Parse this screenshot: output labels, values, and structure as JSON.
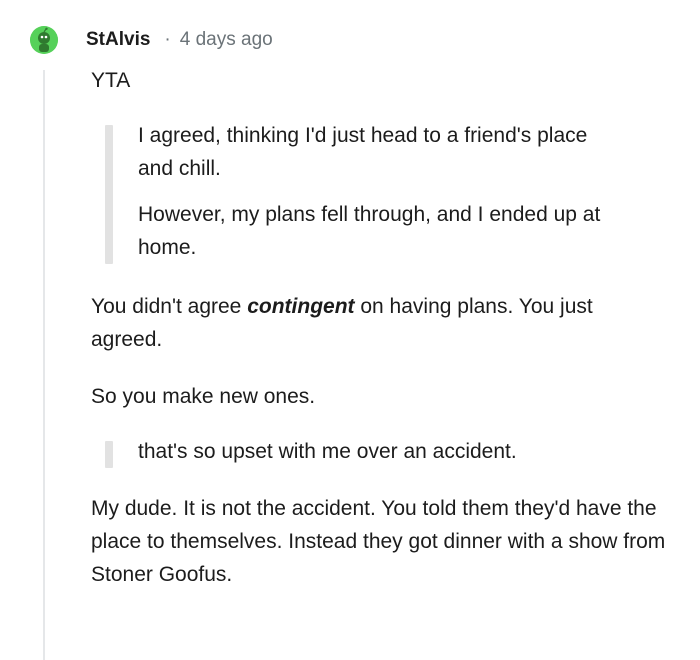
{
  "comment": {
    "username": "StAlvis",
    "separator": "·",
    "timestamp": "4 days ago",
    "verdict": "YTA",
    "quote1": {
      "line1": "I agreed, thinking I'd just head to a friend's place and chill.",
      "line2": "However, my plans fell through, and I ended up at home."
    },
    "reply1": {
      "before": "You didn't agree ",
      "emphasis": "contingent",
      "after": " on having plans. You just agreed."
    },
    "reply2": "So you make new ones.",
    "quote2": "that's so upset with me over an accident.",
    "reply3": "My dude. It is not the accident. You told them they'd have the place to themselves. Instead they got dinner with a show from Stoner Goofus."
  },
  "colors": {
    "avatar": "#56d15a",
    "text": "#1c1c1c",
    "meta": "#6b7378",
    "quote_bar": "#e2e2e2",
    "thread_line": "#e5e7e9"
  },
  "icons": {
    "avatar": "snoo-avatar-icon"
  }
}
